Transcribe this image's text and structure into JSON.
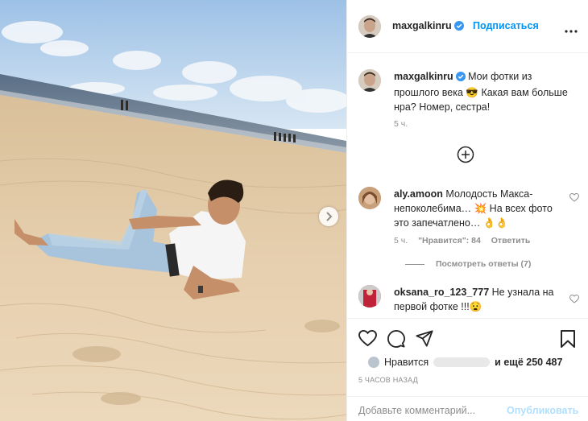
{
  "post": {
    "author": "maxgalkinru",
    "follow_label": "Подписаться",
    "caption_username": "maxgalkinru",
    "caption_text": "Мои фотки из прошлого века 😎 Какая вам больше нра? Номер, сестра!",
    "caption_time": "5 ч."
  },
  "comments": [
    {
      "username": "aly.amoon",
      "text": "Молодость Макса-непоколебима… 💥 На всех фото это запечатлено… 👌👌",
      "time": "5 ч.",
      "likes": "\"Нравится\": 84",
      "reply": "Ответить",
      "view_replies": "Посмотреть ответы (7)"
    },
    {
      "username": "oksana_ro_123_777",
      "text": "Не узнала на первой фотке !!!😧"
    }
  ],
  "likes": {
    "prefix": "Нравится",
    "suffix": "и ещё 250 487"
  },
  "time_ago": "5 ЧАСОВ НАЗАД",
  "comment_input": {
    "placeholder": "Добавьте комментарий...",
    "publish_label": "Опубликовать"
  },
  "icons": {
    "verified": "verified-badge-icon",
    "more": "more-dots-icon",
    "add": "plus-circle-icon",
    "like": "heart-icon",
    "comment": "comment-bubble-icon",
    "share": "paper-plane-icon",
    "save": "bookmark-icon",
    "next": "chevron-right-icon"
  },
  "colors": {
    "accent": "#0095f6",
    "accent_disabled": "#b2dffc",
    "muted": "#8e8e8e",
    "text": "#262626"
  }
}
